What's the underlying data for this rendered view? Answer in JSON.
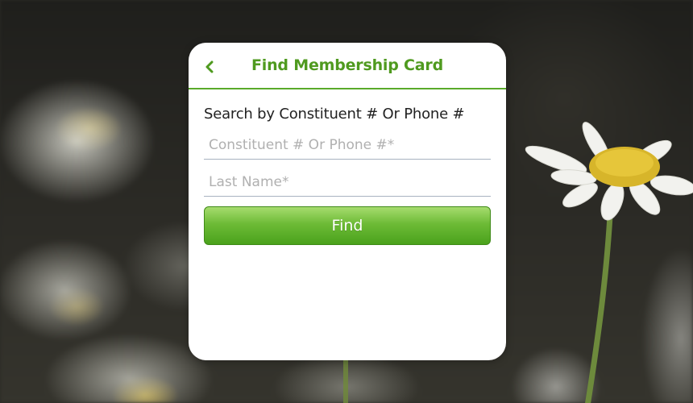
{
  "header": {
    "title": "Find Membership Card",
    "back_icon": "chevron-left-icon"
  },
  "form": {
    "section_label": "Search by Constituent # Or Phone #",
    "constituent_field": {
      "value": "",
      "placeholder": "Constituent # Or Phone #*"
    },
    "last_name_field": {
      "value": "",
      "placeholder": "Last Name*"
    },
    "find_label": "Find"
  },
  "colors": {
    "accent": "#4f9a1f",
    "button_top": "#a6dc6e",
    "button_bottom": "#4aa21c",
    "card_background": "#ffffff"
  }
}
